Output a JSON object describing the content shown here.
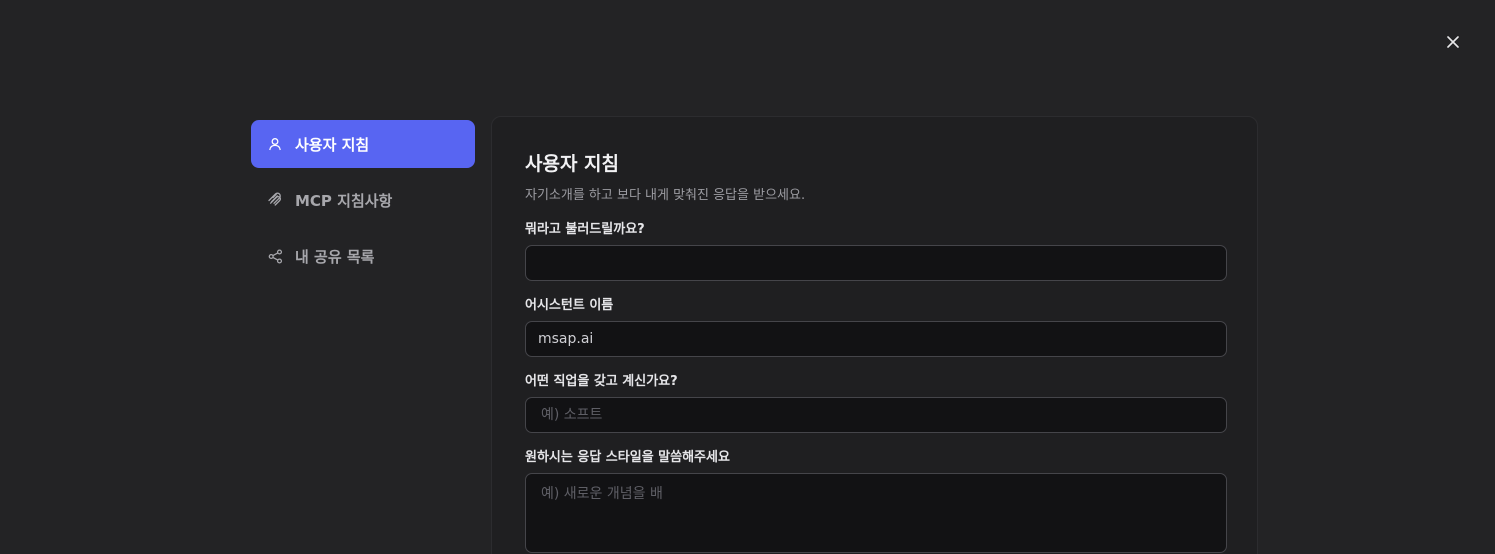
{
  "close": {
    "label": "×"
  },
  "sidebar": {
    "items": [
      {
        "label": "사용자 지침",
        "icon": "user-icon",
        "active": true
      },
      {
        "label": "MCP 지침사항",
        "icon": "mcp-icon",
        "active": false
      },
      {
        "label": "내 공유 목록",
        "icon": "share-icon",
        "active": false
      }
    ]
  },
  "panel": {
    "title": "사용자 지침",
    "subtitle": "자기소개를 하고 보다 내게 맞춰진 응답을 받으세요.",
    "fields": [
      {
        "label": "뭐라고 불러드릴까요?",
        "value": "",
        "placeholder": ""
      },
      {
        "label": "어시스턴트 이름",
        "value": "msap.ai",
        "placeholder": ""
      },
      {
        "label": "어떤 직업을 갖고 계신가요?",
        "value": "",
        "placeholder": "예) 소프트"
      },
      {
        "label": "원하시는 응답 스타일을 말씀해주세요",
        "value": "",
        "placeholder": "예) 새로운 개념을 배"
      }
    ]
  },
  "colors": {
    "background": "#232325",
    "panel": "#1f1f21",
    "accent": "#5865f2",
    "input_bg": "#121214"
  }
}
